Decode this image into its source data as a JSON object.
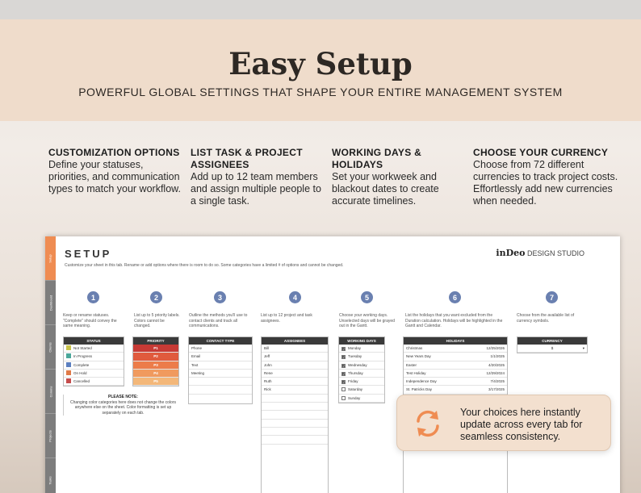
{
  "banner": {
    "title": "Easy Setup",
    "subtitle": "POWERFUL GLOBAL SETTINGS THAT SHAPE YOUR ENTIRE MANAGEMENT SYSTEM"
  },
  "features": [
    {
      "title": "CUSTOMIZATION OPTIONS",
      "text": "Define your statuses, priorities, and communication types to match your workflow."
    },
    {
      "title": "LIST TASK & PROJECT ASSIGNEES",
      "text": "Add up to 12 team members and assign multiple people to a single task."
    },
    {
      "title": "WORKING DAYS & HOLIDAYS",
      "text": "Set your workweek and blackout dates to create accurate timelines."
    },
    {
      "title": "CHOOSE YOUR CURRENCY",
      "text": "Choose from 72 different currencies to track project costs. Effortlessly add new currencies when needed."
    }
  ],
  "sheet": {
    "title": "SETUP",
    "brand_bold": "inDeo",
    "brand_rest": "DESIGN STUDIO",
    "description": "Customize your sheet in this tab. Rename or add options where there is room to do so. Some categories have a limited # of options and cannot be changed.",
    "tabs": [
      "Setup",
      "Dashboard",
      "Clients",
      "Comms",
      "Projects",
      "Tasks",
      "Budget"
    ],
    "steps": [
      "1",
      "2",
      "3",
      "4",
      "5",
      "6",
      "7"
    ],
    "step_descriptions": [
      "Keep or rename statuses. \"Complete\" should convey the same meaning.",
      "List up to 5 priority labels. Colors cannot be changed.",
      "Outline the methods you'll use to contact clients and track all communications.",
      "List up to 12 project and task assignees.",
      "Choose your working days. Unselected days will be grayed out in the Gantt.",
      "List the holidays that you want excluded from the Duration calculation. Holidays will be highlighted in the Gantt and Calendar.",
      "Choose from the available list of currency symbols."
    ],
    "status": {
      "header": "STATUS",
      "items": [
        {
          "label": "Not Started",
          "color": "#c9c34a"
        },
        {
          "label": "In Progress",
          "color": "#4aa79a"
        },
        {
          "label": "Complete",
          "color": "#5b7fc0"
        },
        {
          "label": "On Hold",
          "color": "#e07a48"
        },
        {
          "label": "Cancelled",
          "color": "#c54b4b"
        }
      ]
    },
    "priority": {
      "header": "PRIORITY",
      "items": [
        {
          "label": "P1",
          "color": "#c73a35"
        },
        {
          "label": "P2",
          "color": "#e05a3d"
        },
        {
          "label": "P3",
          "color": "#ec7c4a"
        },
        {
          "label": "P4",
          "color": "#f09a5e"
        },
        {
          "label": "P5",
          "color": "#f3b779"
        }
      ]
    },
    "contact": {
      "header": "CONTACT TYPE",
      "items": [
        "Phone",
        "Email",
        "Text",
        "Meeting"
      ]
    },
    "assignees": {
      "header": "ASSIGNEES",
      "items": [
        "Bill",
        "Jeff",
        "John",
        "Rene",
        "Ruth",
        "Rick"
      ]
    },
    "working_days": {
      "header": "WORKING DAYS",
      "items": [
        {
          "label": "Monday",
          "checked": true
        },
        {
          "label": "Tuesday",
          "checked": true
        },
        {
          "label": "Wednesday",
          "checked": true
        },
        {
          "label": "Thursday",
          "checked": true
        },
        {
          "label": "Friday",
          "checked": true
        },
        {
          "label": "Saturday",
          "checked": false
        },
        {
          "label": "Sunday",
          "checked": false
        }
      ]
    },
    "holidays": {
      "header": "HOLIDAYS",
      "items": [
        {
          "name": "Christmas",
          "date": "12/25/2026"
        },
        {
          "name": "New Years Day",
          "date": "1/1/2025"
        },
        {
          "name": "Easter",
          "date": "4/20/2025"
        },
        {
          "name": "Test Holiday",
          "date": "12/29/2024"
        },
        {
          "name": "Independence Day",
          "date": "7/4/2025"
        },
        {
          "name": "St. Patricks Day",
          "date": "3/17/2025"
        }
      ]
    },
    "currency": {
      "header": "CURRENCY",
      "value": "$",
      "caret": "▾"
    },
    "note": {
      "title": "PLEASE NOTE:",
      "text": "Changing color categories here does not change the colors anywhere else on the sheet. Color formatting is set up separately on each tab."
    }
  },
  "callout": {
    "text": "Your choices here instantly update across every tab for seamless consistency.",
    "icon": "refresh-icon",
    "accent": "#ef8c52"
  }
}
